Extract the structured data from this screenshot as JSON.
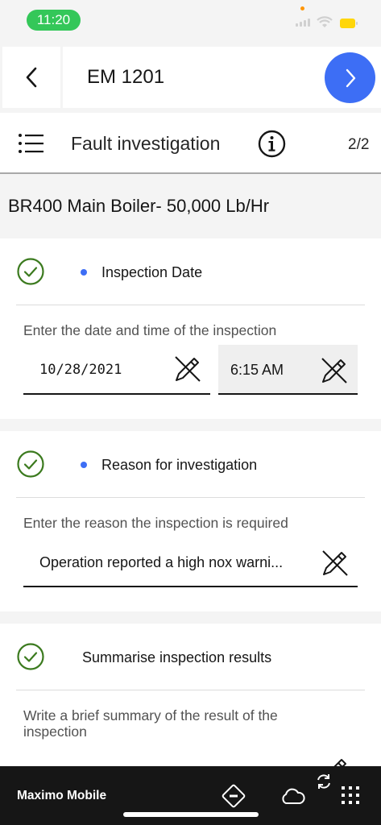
{
  "status": {
    "time": "11:20"
  },
  "header": {
    "work_order": "EM 1201"
  },
  "subheader": {
    "title": "Fault investigation",
    "page": "2/2"
  },
  "asset": {
    "description": "BR400 Main Boiler- 50,000 Lb/Hr"
  },
  "cards": [
    {
      "label": "Inspection Date",
      "required": true,
      "help": "Enter the date and time of the inspection",
      "date_value": "10/28/2021",
      "time_value": "6:15 AM"
    },
    {
      "label": "Reason for investigation",
      "required": true,
      "help": "Enter the reason the inspection is required",
      "value": "Operation reported a high nox warni..."
    },
    {
      "label": "Summarise inspection results",
      "required": false,
      "help_line1": "Write a brief summary of the result of the",
      "help_line2": "inspection"
    }
  ],
  "bottom_bar": {
    "app_name": "Maximo Mobile",
    "icons": [
      "navigation-diamond-icon",
      "cloud-icon",
      "sync-icon",
      "app-grid-icon"
    ]
  },
  "colors": {
    "accent": "#3d6ef5",
    "success": "#24a148",
    "status_pill": "#34c759",
    "bottom_bar": "#161616"
  }
}
